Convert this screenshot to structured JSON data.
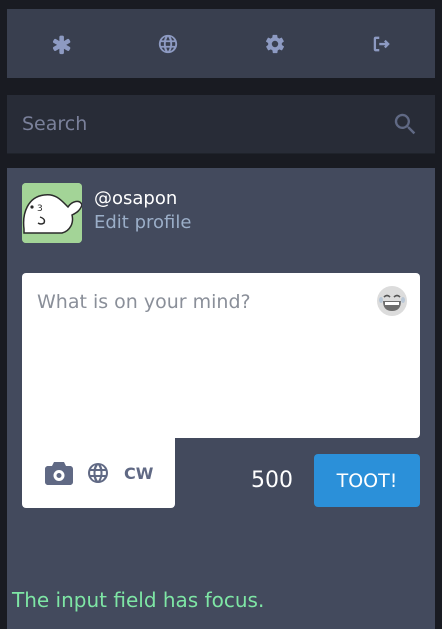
{
  "nav": {
    "items": [
      {
        "icon": "asterisk-icon",
        "label": "Getting started"
      },
      {
        "icon": "globe-icon",
        "label": "Federated timeline"
      },
      {
        "icon": "gear-icon",
        "label": "Preferences"
      },
      {
        "icon": "sign-out-icon",
        "label": "Logout"
      }
    ]
  },
  "search": {
    "placeholder": "Search"
  },
  "account": {
    "username": "@osapon",
    "edit_profile": "Edit profile"
  },
  "compose": {
    "placeholder": "What is on your mind?",
    "value": "",
    "cw_label": "CW",
    "char_count": "500",
    "submit_label": "TOOT!"
  },
  "status": {
    "note": "The input field has focus."
  },
  "colors": {
    "accent": "#2b90d9",
    "panel": "#434a5d",
    "nav": "#393f4f",
    "background": "#191b22"
  }
}
